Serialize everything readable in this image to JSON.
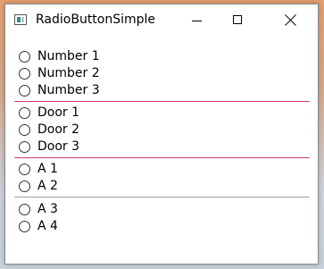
{
  "window": {
    "title": "RadioButtonSimple"
  },
  "colors": {
    "separator_red": "#d04070",
    "separator_gray": "#a0a0a0"
  },
  "groups": [
    {
      "items": [
        "Number 1",
        "Number 2",
        "Number 3"
      ]
    },
    {
      "items": [
        "Door 1",
        "Door 2",
        "Door 3"
      ]
    },
    {
      "items": [
        "A 1",
        "A 2"
      ]
    },
    {
      "items": [
        "A 3",
        "A 4"
      ]
    }
  ]
}
